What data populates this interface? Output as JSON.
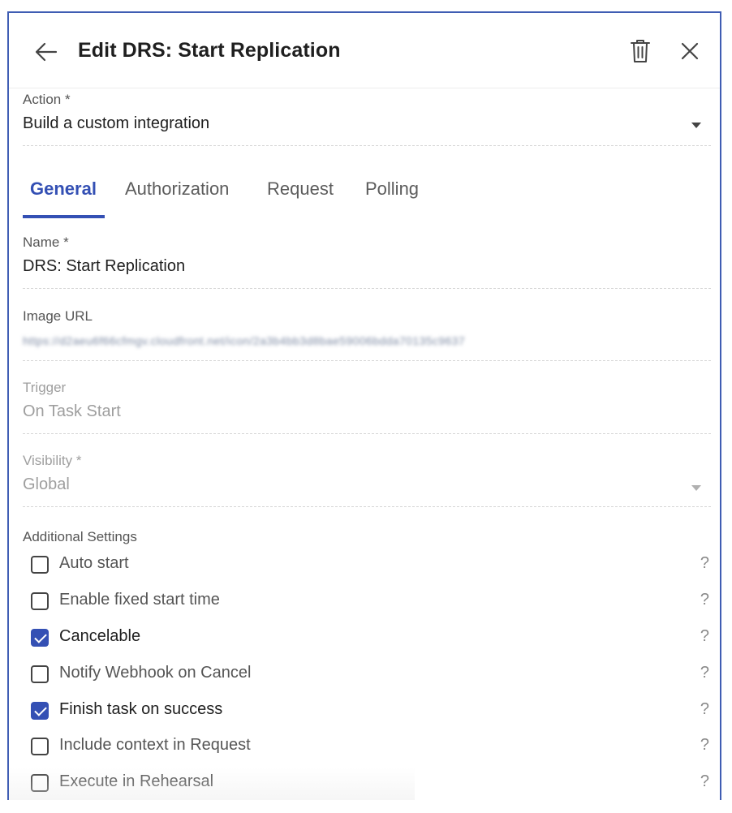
{
  "header": {
    "title": "Edit DRS: Start Replication",
    "back_icon": "arrow-left-icon",
    "delete_icon": "trash-icon",
    "close_icon": "close-icon"
  },
  "action": {
    "label": "Action *",
    "value": "Build a custom integration"
  },
  "tabs": [
    {
      "label": "General",
      "active": true
    },
    {
      "label": "Authorization",
      "active": false
    },
    {
      "label": "Request",
      "active": false
    },
    {
      "label": "Polling",
      "active": false
    }
  ],
  "name": {
    "label": "Name *",
    "value": "DRS: Start Replication"
  },
  "image_url": {
    "label": "Image URL",
    "value": "https://d2aeu6f66cfmgv.cloudfront.net/icon/2a3b4bb3d8bae59006bdda70135c9637"
  },
  "trigger": {
    "label": "Trigger",
    "value": "On Task Start"
  },
  "visibility": {
    "label": "Visibility *",
    "value": "Global"
  },
  "additional_settings": {
    "label": "Additional Settings",
    "help": "?",
    "items": [
      {
        "label": "Auto start",
        "checked": false
      },
      {
        "label": "Enable fixed start time",
        "checked": false
      },
      {
        "label": "Cancelable",
        "checked": true
      },
      {
        "label": "Notify Webhook on Cancel",
        "checked": false
      },
      {
        "label": "Finish task on success",
        "checked": true
      },
      {
        "label": "Include context in Request",
        "checked": false
      },
      {
        "label": "Execute in Rehearsal",
        "checked": false
      }
    ]
  },
  "colors": {
    "accent": "#3450b4",
    "frame_border": "#3f5db3",
    "muted_text": "#9e9e9e"
  }
}
